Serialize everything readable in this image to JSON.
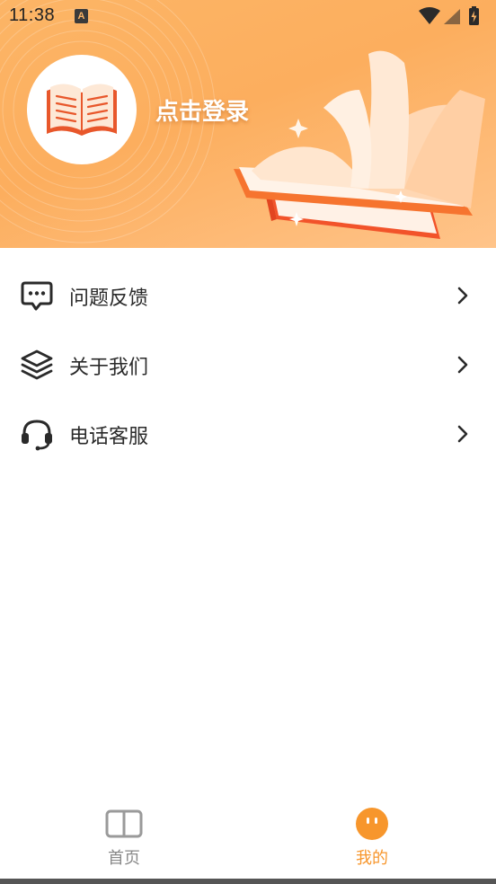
{
  "status_bar": {
    "time": "11:38",
    "notification_icon": "a-notification-icon",
    "icons": [
      "wifi-icon",
      "signal-icon",
      "battery-charging-icon"
    ]
  },
  "header": {
    "avatar_icon": "open-book-icon",
    "login_label": "点击登录",
    "illustration": "books-illustration",
    "gradient_colors": [
      "#fcb566",
      "#ffc48a"
    ]
  },
  "menu": {
    "items": [
      {
        "label": "问题反馈",
        "icon": "message-dots-icon"
      },
      {
        "label": "关于我们",
        "icon": "layers-icon"
      },
      {
        "label": "电话客服",
        "icon": "headset-icon"
      }
    ],
    "arrow_icon": "chevron-right-icon"
  },
  "bottom_nav": {
    "items": [
      {
        "label": "首页",
        "icon": "book-outline-icon",
        "active": false
      },
      {
        "label": "我的",
        "icon": "smiley-icon",
        "active": true
      }
    ],
    "active_color": "#f7962c",
    "inactive_color": "#888888"
  }
}
